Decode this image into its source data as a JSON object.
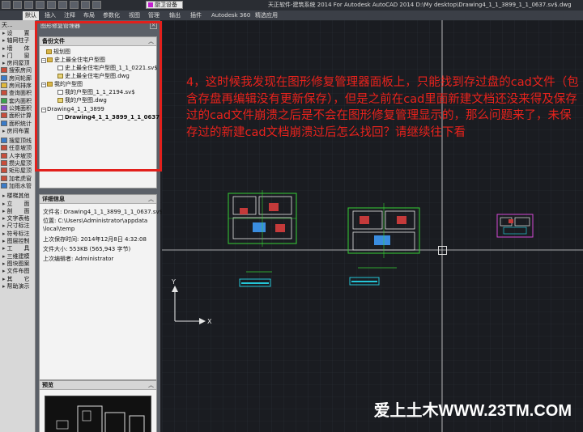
{
  "titlebar": {
    "workspace": "厨卫设备",
    "title": "天正软件-建筑系统 2014   For Autodesk AutoCAD 2014     D:\\My desktop\\Drawing4_1_1_3899_1_1_0637.sv$.dwg"
  },
  "ribbon": {
    "tabs": [
      "默认",
      "插入",
      "注释",
      "布局",
      "参数化",
      "视图",
      "管理",
      "输出",
      "插件",
      "Autodesk 360",
      "精选应用"
    ]
  },
  "toolmenu": {
    "header": "天...",
    "items": [
      "设　　置",
      "轴网柱子",
      "墙　　体",
      "门　　窗",
      "房间屋顶",
      "搜索房间",
      "房间轮廓",
      "房间排序",
      "查询面积",
      "套内面积",
      "公摊面积",
      "面积计算",
      "面积统计",
      "房间布置",
      "搜屋顶线",
      "任意坡顶",
      "人字坡顶",
      "攒尖屋顶",
      "矩形屋顶",
      "加老虎窗",
      "加雨水管",
      "楼梯其他",
      "立　　面",
      "剖　　面",
      "文字表格",
      "尺寸标注",
      "符号标注",
      "图层控制",
      "工　　具",
      "三维建模",
      "图块图案",
      "文件布图",
      "其　　它",
      "帮助演示"
    ]
  },
  "panel": {
    "title": "图形修复管理器",
    "backups_header": "备份文件",
    "tree": [
      "规划图",
      "史上最全住宅户型图",
      "史上最全住宅户型图_1_1_0221.sv$",
      "史上最全住宅户型图.dwg",
      "我的户型图",
      "我的户型图_1_1_2194.sv$",
      "我的户型图.dwg",
      "Drawing4_1_1_3899",
      "Drawing4_1_1_3899_1_1_0637.sv$"
    ],
    "details_header": "详细信息",
    "details": [
      "文件名: Drawing4_1_1_3899_1_1_0637.sv$",
      "位置: C:\\Users\\Administrator\\appdata",
      "\\local\\temp",
      "上次保存时间: 2014年12月8日     4:32:08",
      "文件大小: 553KB (565,943 字节)",
      "上次编辑者: Administrator"
    ],
    "preview_header": "预览"
  },
  "canvas": {
    "annotation": "4，这时候我发现在图形修复管理器面板上，只能找到存过盘的cad文件（包含存盘再编辑没有更新保存），但是之前在cad里面新建文档还没来得及保存过的cad文件崩溃之后是不会在图形修复管理显示的，那么问题来了，未保存过的新建cad文档崩溃过后怎么找回？请继续往下看",
    "watermark": "爱上土木WWW.23TM.COM"
  },
  "colors": {
    "annotation": "#e8221c",
    "highlight_box": "#e2201c",
    "canvas_bg": "#1a1c21"
  }
}
